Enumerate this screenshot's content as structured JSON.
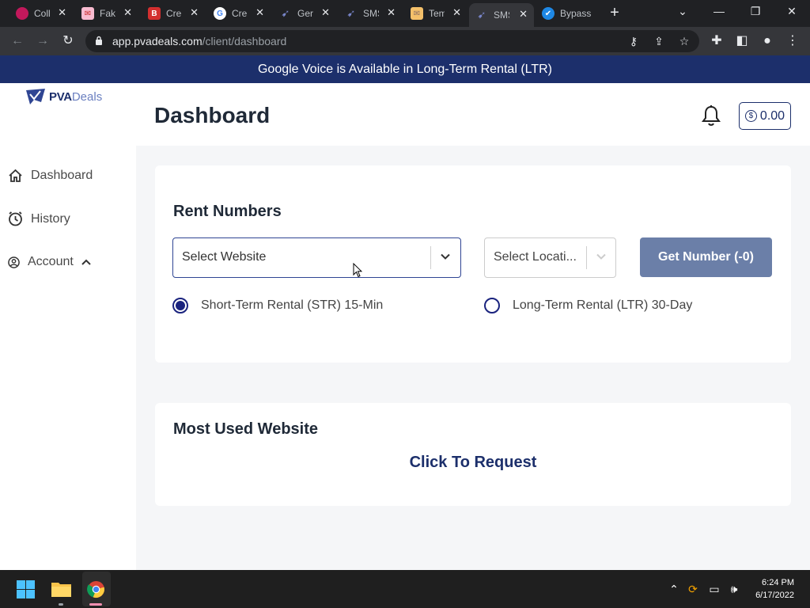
{
  "browser": {
    "tabs": [
      {
        "title": "Coll",
        "favicon": "purple-circle-icon",
        "color": "#c2185b"
      },
      {
        "title": "Fak",
        "favicon": "mail-icon",
        "color": "#e57373"
      },
      {
        "title": "Cre",
        "favicon": "b-letter-icon",
        "color": "#d32f2f"
      },
      {
        "title": "Cre",
        "favicon": "google-icon",
        "color": "#ffffff"
      },
      {
        "title": "Ger",
        "favicon": "pva-icon",
        "color": "#3f51b5"
      },
      {
        "title": "SMS",
        "favicon": "pva-icon",
        "color": "#3f51b5"
      },
      {
        "title": "Tem",
        "favicon": "envelope-icon",
        "color": "#f4c06a"
      },
      {
        "title": "SMS",
        "favicon": "pva-icon",
        "color": "#3f51b5",
        "active": true
      },
      {
        "title": "Bypass",
        "favicon": "check-icon",
        "color": "#1e88e5"
      }
    ],
    "url_host": "app.pvadeals.com",
    "url_path": "/client/dashboard"
  },
  "banner": {
    "text": "Google Voice is Available in Long-Term Rental (LTR)"
  },
  "logo": {
    "part1": "PVA",
    "part2": "Deals"
  },
  "sidebar": {
    "items": [
      {
        "label": "Dashboard",
        "icon": "home-icon"
      },
      {
        "label": "History",
        "icon": "clock-icon"
      },
      {
        "label": "Account",
        "icon": "user-circle-icon"
      }
    ]
  },
  "header": {
    "title": "Dashboard",
    "balance": "0.00"
  },
  "rent": {
    "title": "Rent Numbers",
    "website_placeholder": "Select Website",
    "location_placeholder": "Select Locati...",
    "get_number_label": "Get Number (-0)",
    "options": [
      {
        "label": "Short-Term Rental (STR) 15-Min",
        "selected": true
      },
      {
        "label": "Long-Term Rental (LTR) 30-Day",
        "selected": false
      }
    ]
  },
  "most_used": {
    "title": "Most Used Website",
    "action": "Click To Request"
  },
  "taskbar": {
    "time": "6:24 PM",
    "date": "6/17/2022"
  },
  "colors": {
    "brand": "#1c2f6b",
    "button": "#6b7fa8",
    "radio": "#1a237e"
  }
}
